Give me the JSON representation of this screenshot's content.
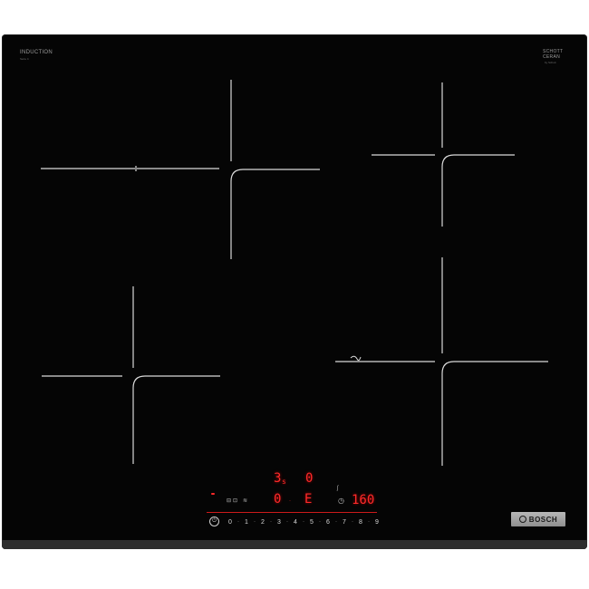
{
  "brand_top_left": {
    "title": "INDUCTION",
    "subtitle": "Serie 4"
  },
  "brand_top_right": {
    "line1": "SCHOTT",
    "line2": "CERAN",
    "line3": "by Schott"
  },
  "display": {
    "zone_indicator_top_left": "3",
    "zone_indicator_top_left_sub": "s",
    "zone_indicator_top_right": "0",
    "zone_value_left": "0",
    "zone_value_mid": "E",
    "timer_value": "160"
  },
  "scale": {
    "levels": [
      "0",
      "1",
      "2",
      "3",
      "4",
      "5",
      "6",
      "7",
      "8",
      "9"
    ]
  },
  "badge": {
    "label": "BOSCH"
  },
  "colors": {
    "glass": "#050505",
    "display_red": "#ff2a2a",
    "zone_outline": "#d9d9d9"
  },
  "icons": {
    "power": "power-icon",
    "lock": "child-lock-icon",
    "flex": "flex-zone-icon",
    "timer": "timer-icon",
    "heat": "heat-icon"
  }
}
